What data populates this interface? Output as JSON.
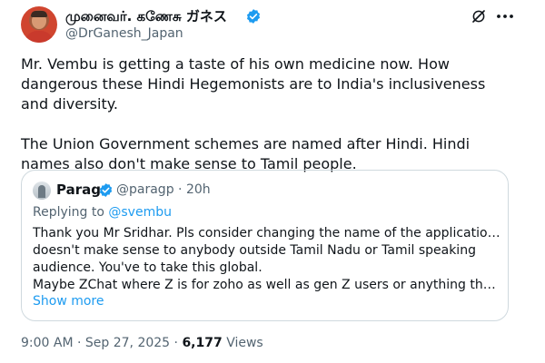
{
  "author": {
    "display_name": "முனைவர். கணேசு ガネス",
    "handle": "@DrGanesh_Japan"
  },
  "tweet": {
    "paragraphs": [
      "Mr. Vembu is getting a taste of his own medicine now. How dangerous these Hindi Hegemonists are to India's inclusiveness and diversity.",
      "The Union Government schemes are named after Hindi. Hindi names also don't make sense to Tamil people."
    ]
  },
  "quote": {
    "author_name": "Parag",
    "handle": "@paragp",
    "separator": "·",
    "time": "20h",
    "replying_prefix": "Replying to",
    "replying_to": "@svembu",
    "lines": [
      "Thank you Mr Sridhar. Pls consider changing the name of the application. It",
      "doesn't make sense to anybody outside Tamil Nadu or Tamil speaking",
      "audience. You've to take this global.",
      "Maybe ZChat where Z is for zoho as well as gen Z users or anything that make..."
    ],
    "show_more": "Show more"
  },
  "footer": {
    "timestamp": "9:00 AM · Sep 27, 2025 ·",
    "views_count": "6,177",
    "views_label": "Views"
  },
  "colors": {
    "accent": "#1d9bf0",
    "text": "#0f1419",
    "muted": "#536471",
    "border": "#cfd9de"
  },
  "icons": [
    "verified-badge-icon",
    "grok-icon",
    "more-options-icon"
  ]
}
